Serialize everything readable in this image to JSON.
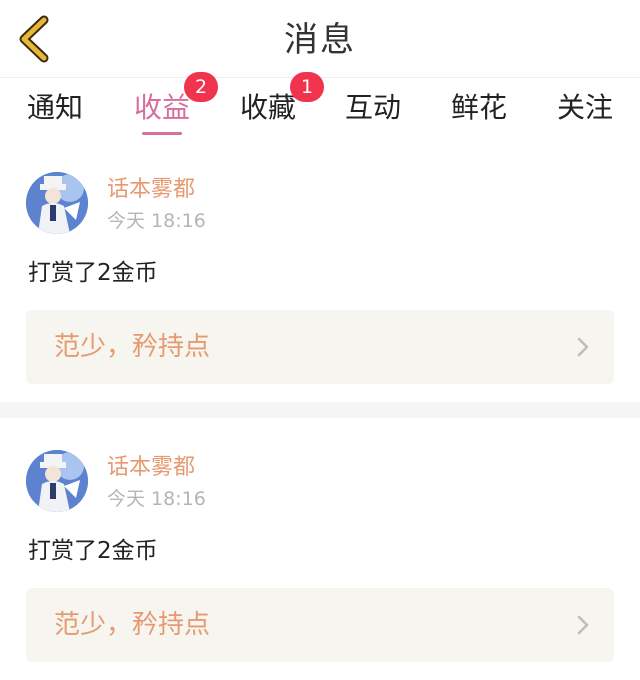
{
  "header": {
    "title": "消息",
    "back_icon": "chevron-left-icon",
    "back_color": "#e8b73a"
  },
  "tabs": [
    {
      "label": "通知",
      "badge": null,
      "active": false
    },
    {
      "label": "收益",
      "badge": "2",
      "active": true
    },
    {
      "label": "收藏",
      "badge": "1",
      "active": false
    },
    {
      "label": "互动",
      "badge": null,
      "active": false
    },
    {
      "label": "鲜花",
      "badge": null,
      "active": false
    },
    {
      "label": "关注",
      "badge": null,
      "active": false
    }
  ],
  "colors": {
    "active_tab": "#d86e9c",
    "badge": "#f0344d",
    "username": "#e79a72",
    "content_text": "#e79a72",
    "content_bg": "#f6f5f0"
  },
  "messages": [
    {
      "username": "话本雾都",
      "time": "今天 18:16",
      "action": "打赏了2金币",
      "content": "范少，矜持点",
      "avatar_icon": "user-avatar-icon"
    },
    {
      "username": "话本雾都",
      "time": "今天 18:16",
      "action": "打赏了2金币",
      "content": "范少，矜持点",
      "avatar_icon": "user-avatar-icon"
    }
  ]
}
